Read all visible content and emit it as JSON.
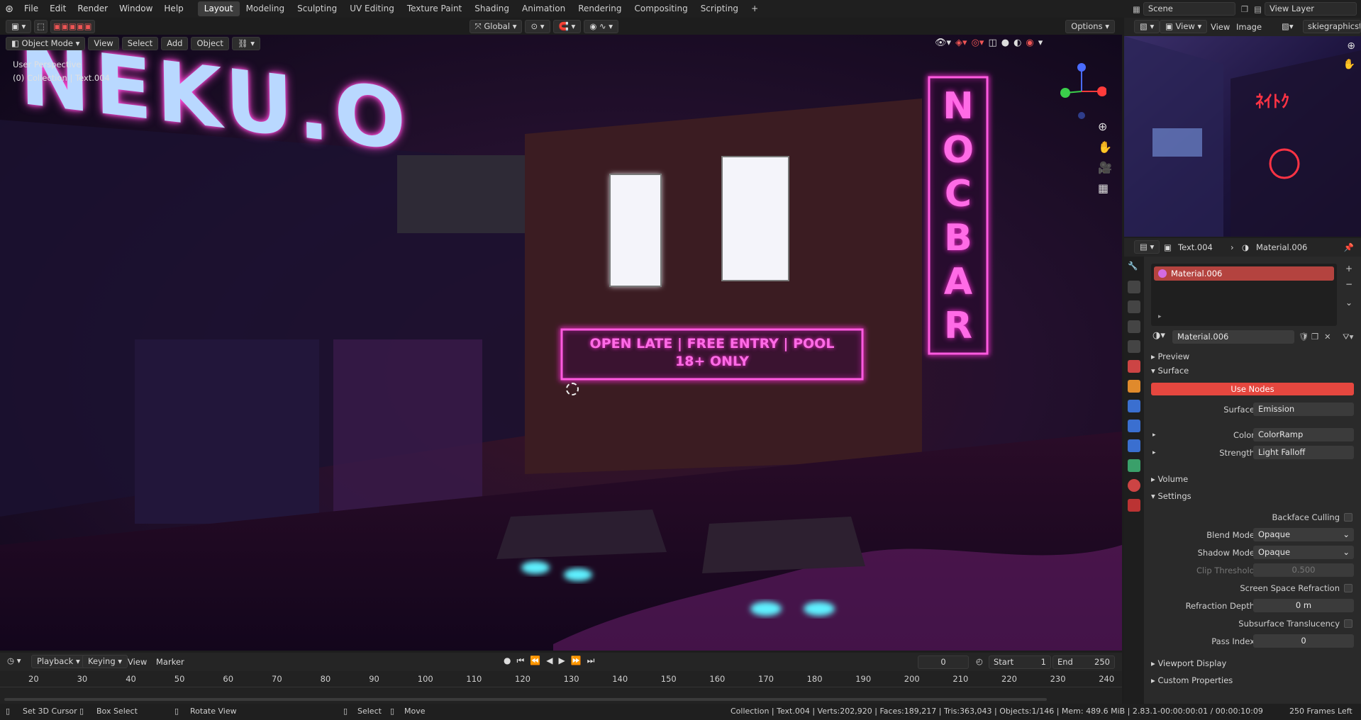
{
  "topbar": {
    "menus": [
      "File",
      "Edit",
      "Render",
      "Window",
      "Help"
    ],
    "workspaces": [
      "Layout",
      "Modeling",
      "Sculpting",
      "UV Editing",
      "Texture Paint",
      "Shading",
      "Animation",
      "Rendering",
      "Compositing",
      "Scripting"
    ],
    "active_workspace": "Layout",
    "add": "+",
    "scene": "Scene",
    "view_layer": "View Layer"
  },
  "viewport": {
    "mode": "Object Mode",
    "menus": [
      "View",
      "Select",
      "Add",
      "Object"
    ],
    "orientation": "Global",
    "options": "Options",
    "overlay_line1": "User Perspective",
    "overlay_line2": "(0) Collection | Text.004",
    "sign_main": "OPEN LATE | FREE ENTRY | POOL",
    "sign_sub": "18+ ONLY",
    "sign_top": "NEKU.O",
    "sign_vertical": "NOCBAR"
  },
  "timeline": {
    "playback": "Playback",
    "keying": "Keying",
    "view": "View",
    "marker": "Marker",
    "current": "0",
    "start_label": "Start",
    "start": "1",
    "end_label": "End",
    "end": "250",
    "ticks": [
      "20",
      "30",
      "40",
      "50",
      "60",
      "70",
      "80",
      "90",
      "100",
      "110",
      "120",
      "130",
      "140",
      "150",
      "160",
      "170",
      "180",
      "190",
      "200",
      "210",
      "220",
      "230",
      "240"
    ]
  },
  "status": {
    "cursor": "Set 3D Cursor",
    "box": "Box Select",
    "rotate": "Rotate View",
    "select": "Select",
    "move": "Move",
    "info": "Collection | Text.004 | Verts:202,920 | Faces:189,217 | Tris:363,043 | Objects:1/146 | Mem: 489.6 MiB | 2.83.1",
    "time": "-00:00:00:01 / 00:00:10:09",
    "frames": "250 Frames Left"
  },
  "image_editor": {
    "view": "View",
    "menu_view": "View",
    "image": "Image",
    "name": "skiegraphicstudio"
  },
  "properties": {
    "object": "Text.004",
    "material": "Material.006",
    "slot": "Material.006",
    "datablock": "Material.006",
    "preview": "Preview",
    "surface_panel": "Surface",
    "use_nodes": "Use Nodes",
    "surface_label": "Surface",
    "surface_value": "Emission",
    "color_label": "Color",
    "color_value": "ColorRamp",
    "strength_label": "Strength",
    "strength_value": "Light Falloff",
    "volume": "Volume",
    "settings": "Settings",
    "backface": "Backface Culling",
    "blend_label": "Blend Mode",
    "blend_value": "Opaque",
    "shadow_label": "Shadow Mode",
    "shadow_value": "Opaque",
    "clip_label": "Clip Threshold",
    "clip_value": "0.500",
    "ssr": "Screen Space Refraction",
    "refr_label": "Refraction Depth",
    "refr_value": "0 m",
    "sss": "Subsurface Translucency",
    "pass_label": "Pass Index",
    "pass_value": "0",
    "viewport_display": "Viewport Display",
    "custom": "Custom Properties"
  },
  "colors": {
    "accent": "#d9534f",
    "neon_pink": "#ff2bd6",
    "neon_cyan": "#5ff0ff"
  }
}
